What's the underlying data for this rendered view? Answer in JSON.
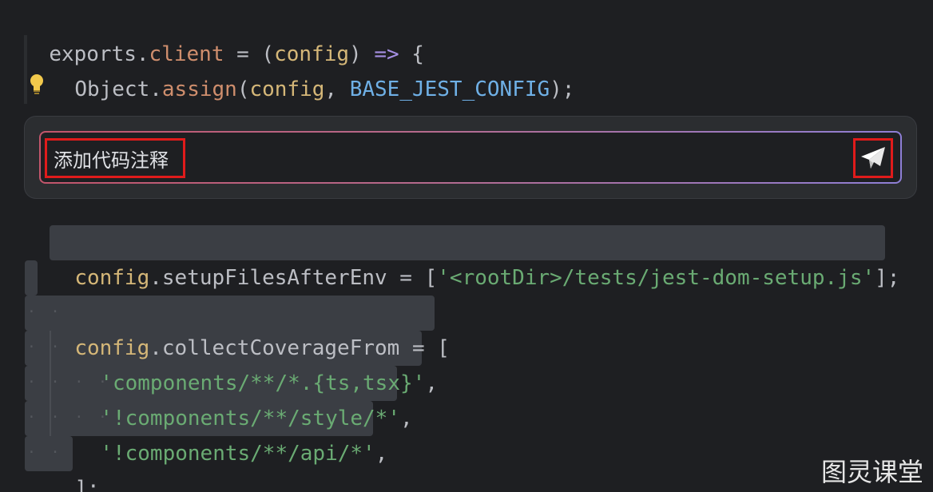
{
  "editor": {
    "line1": {
      "t1": "exports",
      "t2": ".",
      "t3": "client",
      "t4": " = (",
      "t5": "config",
      "t6": ") ",
      "t7": "=>",
      "t8": " {"
    },
    "line2": {
      "t1": "Object",
      "t2": ".",
      "t3": "assign",
      "t4": "(",
      "t5": "config",
      "t6": ", ",
      "t7": "BASE_JEST_CONFIG",
      "t8": ");"
    },
    "line3": {
      "t1": "config",
      "t2": ".setupFilesAfterEnv = [",
      "t3": "'<rootDir>/tests/jest-dom-setup.js'",
      "t4": "];"
    },
    "line4": {
      "t1": "config",
      "t2": ".collectCoverageFrom = ["
    },
    "line5": {
      "t1": "'components/**/*.{ts,tsx}'",
      "t2": ","
    },
    "line6": {
      "t1": "'!components/**/style/*'",
      "t2": ","
    },
    "line7": {
      "t1": "'!components/**/api/*'",
      "t2": ","
    },
    "line8": {
      "t1": "];"
    }
  },
  "ai_prompt": {
    "input_value": "添加代码注释",
    "send_icon": "send-paper-plane-icon",
    "hint_icon": "lightbulb-icon"
  },
  "watermark": "图灵课堂",
  "colors": {
    "background": "#1e1f22",
    "panel": "#2b2d30",
    "selection": "#3b3e44",
    "highlight_box": "#e01b1b",
    "string": "#6aab73",
    "keyword": "#a58fe3",
    "constant": "#6fb0e6",
    "property": "#cf8e6d",
    "param": "#d5b778"
  }
}
